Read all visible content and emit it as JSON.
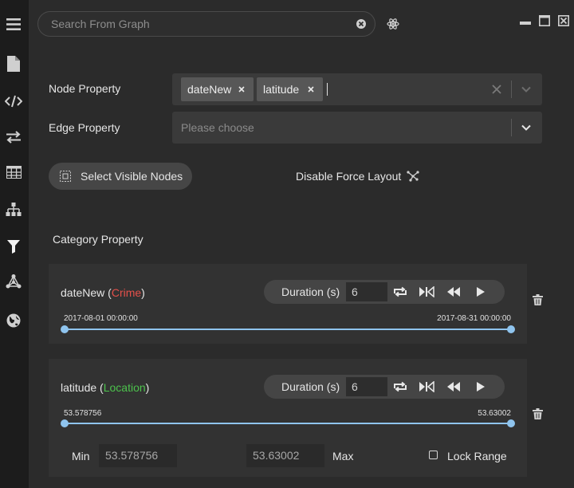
{
  "sidebar": {
    "items": [
      {
        "icon": "menu-icon"
      },
      {
        "icon": "document-icon"
      },
      {
        "icon": "code-icon"
      },
      {
        "icon": "transfer-icon"
      },
      {
        "icon": "table-icon"
      },
      {
        "icon": "hierarchy-icon"
      },
      {
        "icon": "filter-icon",
        "active": true
      },
      {
        "icon": "graph-icon"
      },
      {
        "icon": "globe-icon"
      }
    ]
  },
  "search": {
    "placeholder": "Search From Graph",
    "value": ""
  },
  "filters": {
    "node_property_label": "Node Property",
    "node_property_tags": [
      "dateNew",
      "latitude"
    ],
    "edge_property_label": "Edge Property",
    "edge_property_placeholder": "Please choose",
    "select_visible_label": "Select Visible Nodes",
    "disable_force_label": "Disable Force Layout",
    "category_label": "Category Property"
  },
  "cards": [
    {
      "title": "dateNew",
      "open_paren": "(",
      "category": "Crime",
      "close_paren": ")",
      "category_color": "#e5504a",
      "duration_label": "Duration (s)",
      "duration_value": "6",
      "range_min_label": "2017-08-01 00:00:00",
      "range_max_label": "2017-08-31 00:00:00"
    },
    {
      "title": "latitude",
      "open_paren": "(",
      "category": "Location",
      "close_paren": ")",
      "category_color": "#4cc24c",
      "duration_label": "Duration (s)",
      "duration_value": "6",
      "range_min_label": "53.578756",
      "range_max_label": "53.63002",
      "min_label": "Min",
      "min_value": "53.578756",
      "max_value": "53.63002",
      "max_label": "Max",
      "lock_label": "Lock Range",
      "lock_checked": false
    }
  ],
  "colors": {
    "accent": "#8fc4ee",
    "background": "#2b2b2b",
    "sidebar": "#1c1c1c"
  }
}
